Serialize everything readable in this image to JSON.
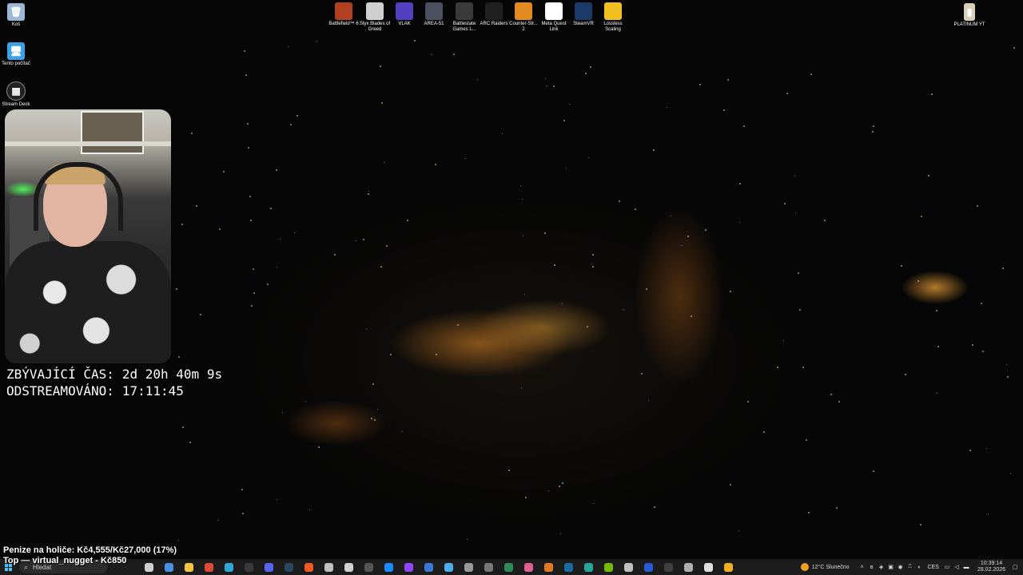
{
  "desktop": {
    "left_icons": [
      {
        "label": "Koš",
        "icon": "recycle-bin-icon",
        "color": "#9bb7d6"
      },
      {
        "label": "Tento počítač",
        "icon": "computer-icon",
        "color": "#3aa0e8"
      },
      {
        "label": "Stream Deck",
        "icon": "stream-deck-icon",
        "color": "#222222"
      }
    ],
    "top_icons": [
      {
        "label": "Battlefield™ 6",
        "icon": "battlefield-6-icon",
        "color": "#b04020"
      },
      {
        "label": "Styx Blades of Greed",
        "icon": "styx-icon",
        "color": "#cfcfcf"
      },
      {
        "label": "VLAK",
        "icon": "vlak-train-icon",
        "color": "#5040c0"
      },
      {
        "label": "AREA-51",
        "icon": "area-51-icon",
        "color": "#4a5060"
      },
      {
        "label": "Battlestate Games L...",
        "icon": "battlestate-launcher-icon",
        "color": "#3a3a3a"
      },
      {
        "label": "ARC Raiders",
        "icon": "arc-raiders-icon",
        "color": "#202020"
      },
      {
        "label": "Counter-Str... 2",
        "icon": "counter-strike-2-icon",
        "color": "#e08a20"
      },
      {
        "label": "Meta Quest Link",
        "icon": "meta-quest-link-icon",
        "color": "#ffffff"
      },
      {
        "label": "SteamVR",
        "icon": "steamvr-icon",
        "color": "#1b3a6a"
      },
      {
        "label": "Lossless Scaling",
        "icon": "lossless-scaling-icon",
        "color": "#f0c020"
      }
    ],
    "right_icon": {
      "label": "PLATINUM YT",
      "icon": "platinum-yt-icon",
      "color": "#d8d0b8"
    }
  },
  "overlay": {
    "remaining_label": "ZBÝVAJÍCÍ ČAS:",
    "remaining_value": "2d 20h 40m 9s",
    "streamed_label": "ODSTREAMOVÁNO:",
    "streamed_value": "17:11:45",
    "donation_text": "Penize na holiče: Kč4,555/Kč27,000 (17%)",
    "donation_progress": 0.17,
    "top_donor_text": "Top — virtual_nugget - Kč850"
  },
  "taskbar": {
    "search_placeholder": "Hledat",
    "apps": [
      {
        "icon": "task-view-icon",
        "color": "#cfcfcf"
      },
      {
        "icon": "widgets-icon",
        "color": "#4a90e2"
      },
      {
        "icon": "file-explorer-icon",
        "color": "#f5c542"
      },
      {
        "icon": "chrome-icon",
        "color": "#e04a3a"
      },
      {
        "icon": "edge-icon",
        "color": "#2fa8d8"
      },
      {
        "icon": "obs-icon",
        "color": "#3a3a3a"
      },
      {
        "icon": "discord-icon",
        "color": "#5865f2"
      },
      {
        "icon": "steam-icon",
        "color": "#2a475e"
      },
      {
        "icon": "origin-icon",
        "color": "#f05a22"
      },
      {
        "icon": "app-circle-icon",
        "color": "#c0c0c0"
      },
      {
        "icon": "msi-icon",
        "color": "#d0d0d0"
      },
      {
        "icon": "app-dark-icon",
        "color": "#555555"
      },
      {
        "icon": "battlenet-icon",
        "color": "#1a8cff"
      },
      {
        "icon": "twitch-icon",
        "color": "#9146ff"
      },
      {
        "icon": "app-blue-icon",
        "color": "#3a78d8"
      },
      {
        "icon": "app-sky-icon",
        "color": "#4ab0f0"
      },
      {
        "icon": "app-gray-icon",
        "color": "#9a9a9a"
      },
      {
        "icon": "app-dot-icon",
        "color": "#777777"
      },
      {
        "icon": "app-green-icon",
        "color": "#2e8b57"
      },
      {
        "icon": "app-colorful-icon",
        "color": "#e06090"
      },
      {
        "icon": "app-orange-icon",
        "color": "#e07a20"
      },
      {
        "icon": "steam-2-icon",
        "color": "#1b6aa0"
      },
      {
        "icon": "app-teal-icon",
        "color": "#26a69a"
      },
      {
        "icon": "nvidia-icon",
        "color": "#76b900"
      },
      {
        "icon": "app-g-icon",
        "color": "#c0c0c0"
      },
      {
        "icon": "malwarebytes-icon",
        "color": "#2a5bd7"
      },
      {
        "icon": "app-dark-2-icon",
        "color": "#404040"
      },
      {
        "icon": "app-grid-icon",
        "color": "#b0b0b0"
      },
      {
        "icon": "app-light-icon",
        "color": "#e0e0e0"
      },
      {
        "icon": "app-yellow-icon",
        "color": "#f0b020"
      }
    ],
    "weather": "12°C Slunečno",
    "language": "CES",
    "time": "10:39:14",
    "date": "28.02.2026"
  }
}
